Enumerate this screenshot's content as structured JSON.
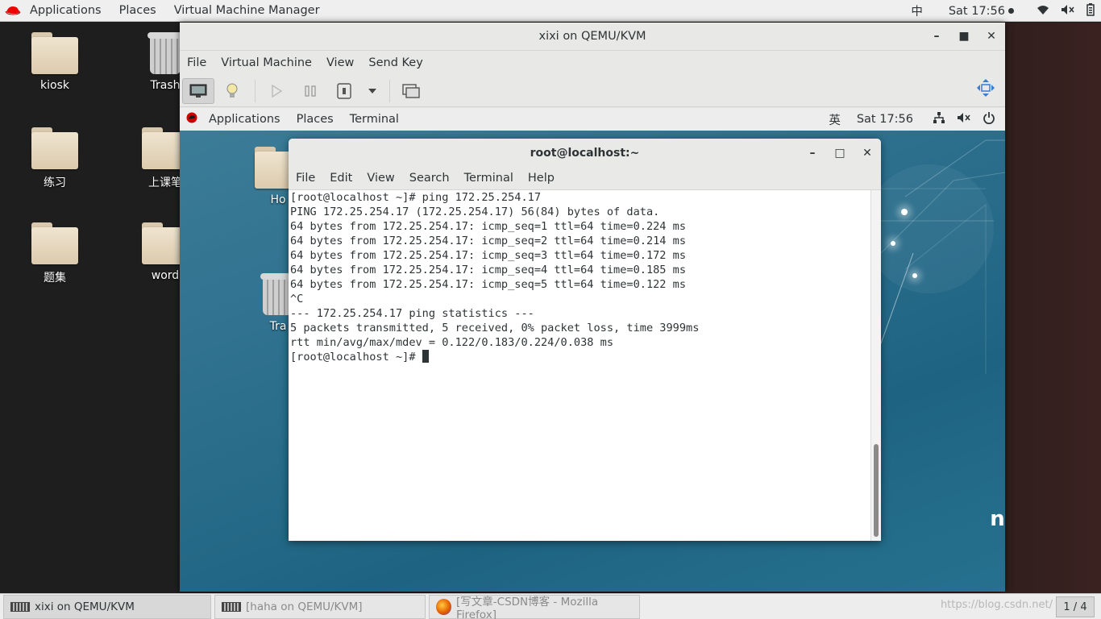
{
  "top_bar": {
    "menus": [
      "Applications",
      "Places",
      "Virtual Machine Manager"
    ],
    "input_method": "中",
    "clock": "Sat 17:56"
  },
  "desktop": {
    "icons": [
      {
        "label": "kiosk",
        "type": "folder"
      },
      {
        "label": "Trash",
        "type": "trash"
      },
      {
        "label": "练习",
        "type": "folder"
      },
      {
        "label": "上课笔",
        "type": "folder"
      },
      {
        "label": "题集",
        "type": "folder"
      },
      {
        "label": "word",
        "type": "folder"
      }
    ]
  },
  "vm_window": {
    "title": "xixi on QEMU/KVM",
    "menu": [
      "File",
      "Virtual Machine",
      "View",
      "Send Key"
    ],
    "toolbar": [
      "console-view-icon",
      "details-icon",
      "run-icon",
      "pause-icon",
      "shutdown-icon",
      "dropdown-icon",
      "screenshot-icon",
      "fullscreen-icon"
    ]
  },
  "guest": {
    "top_bar": {
      "menus": [
        "Applications",
        "Places",
        "Terminal"
      ],
      "input_method": "英",
      "clock": "Sat 17:56"
    },
    "icons": [
      {
        "label": "Ho"
      },
      {
        "label": "Tra"
      }
    ],
    "brand_fragment": "nux"
  },
  "terminal": {
    "title": "root@localhost:~",
    "menu": [
      "File",
      "Edit",
      "View",
      "Search",
      "Terminal",
      "Help"
    ],
    "lines": [
      "[root@localhost ~]# ping 172.25.254.17",
      "PING 172.25.254.17 (172.25.254.17) 56(84) bytes of data.",
      "64 bytes from 172.25.254.17: icmp_seq=1 ttl=64 time=0.224 ms",
      "64 bytes from 172.25.254.17: icmp_seq=2 ttl=64 time=0.214 ms",
      "64 bytes from 172.25.254.17: icmp_seq=3 ttl=64 time=0.172 ms",
      "64 bytes from 172.25.254.17: icmp_seq=4 ttl=64 time=0.185 ms",
      "64 bytes from 172.25.254.17: icmp_seq=5 ttl=64 time=0.122 ms",
      "^C",
      "--- 172.25.254.17 ping statistics ---",
      "5 packets transmitted, 5 received, 0% packet loss, time 3999ms",
      "rtt min/avg/max/mdev = 0.122/0.183/0.224/0.038 ms"
    ],
    "prompt": "[root@localhost ~]# "
  },
  "taskbar": {
    "tasks": [
      {
        "label": "xixi on QEMU/KVM",
        "active": true
      },
      {
        "label": "[haha on QEMU/KVM]",
        "active": false
      },
      {
        "label": "[写文章-CSDN博客 - Mozilla Firefox]",
        "active": false
      }
    ],
    "workspace": "1 / 4",
    "watermark": "https://blog.csdn.net/"
  },
  "colors": {
    "guest_bg": "#2c6f8d",
    "panel": "#ededed",
    "redhat_red": "#ee0000"
  }
}
